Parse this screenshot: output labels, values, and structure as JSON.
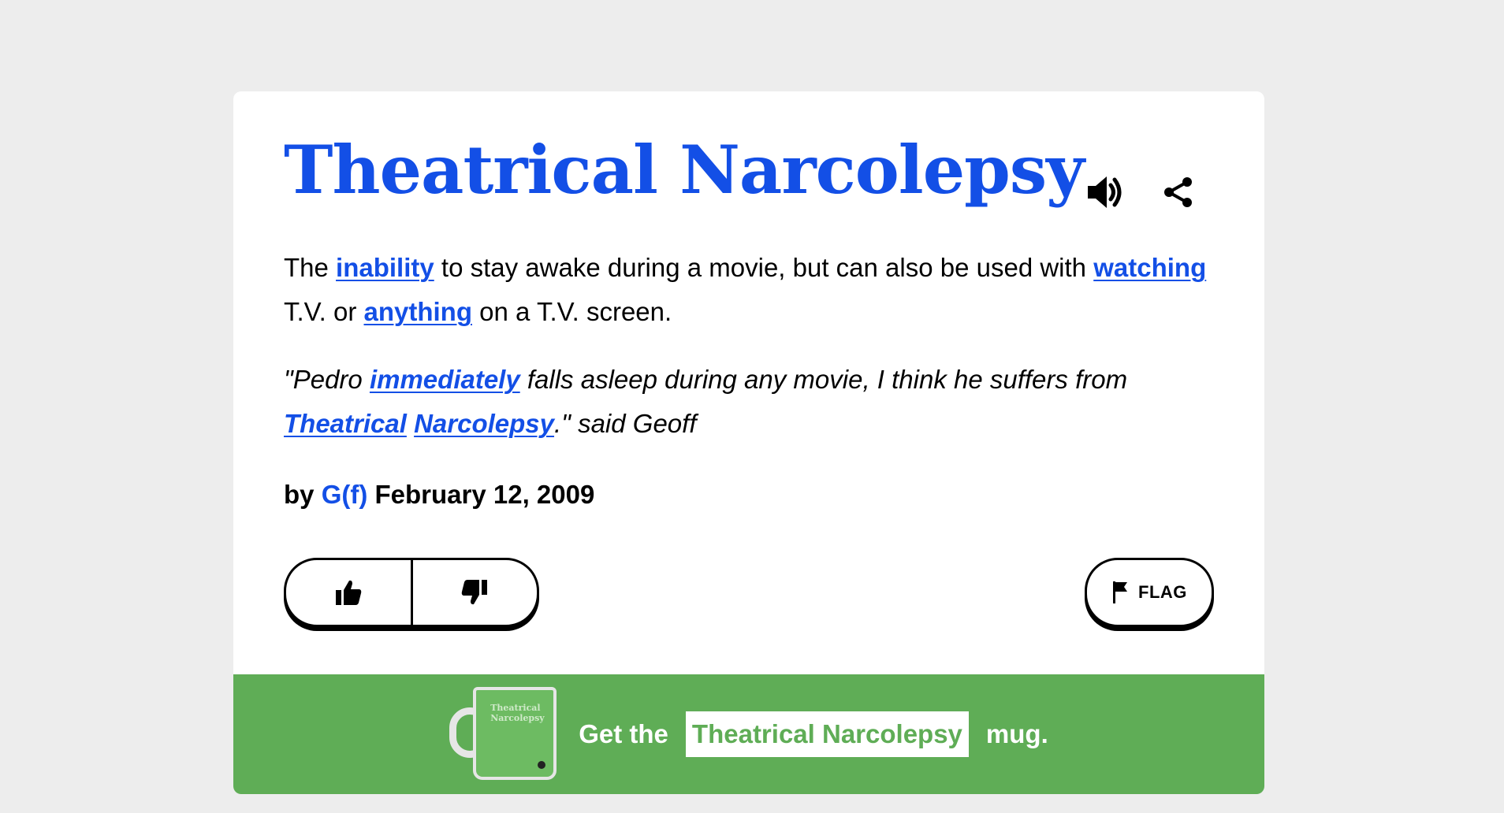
{
  "entry": {
    "word": "Theatrical Narcolepsy",
    "meaning": {
      "t1": "The ",
      "l1": "inability",
      "t2": " to stay awake during a movie, but can also be used with ",
      "l2": "watching",
      "t3": " T.V. or ",
      "l3": "anything",
      "t4": " on a T.V. screen."
    },
    "example": {
      "t1": "\"Pedro ",
      "l1": "immediately",
      "t2": " falls asleep during any movie, I think he suffers from ",
      "l2": "Theatrical",
      "t3": " ",
      "l3": "Narcolepsy",
      "t4": ".\" said Geoff"
    },
    "contributor": {
      "by": "by ",
      "author": "G(f)",
      "date": " February 12, 2009"
    }
  },
  "actions": {
    "sound_icon": "speaker-icon",
    "share_icon": "share-icon",
    "upvote_icon": "thumbs-up-icon",
    "downvote_icon": "thumbs-down-icon",
    "flag_icon": "flag-icon",
    "flag_label": "FLAG"
  },
  "promo": {
    "mug_text": "Theatrical Narcolepsy",
    "prefix": "Get the",
    "product": "Theatrical Narcolepsy",
    "suffix": "mug."
  },
  "colors": {
    "link": "#134fe6",
    "promo_bg": "#5fad56",
    "page_bg": "#ededed"
  }
}
